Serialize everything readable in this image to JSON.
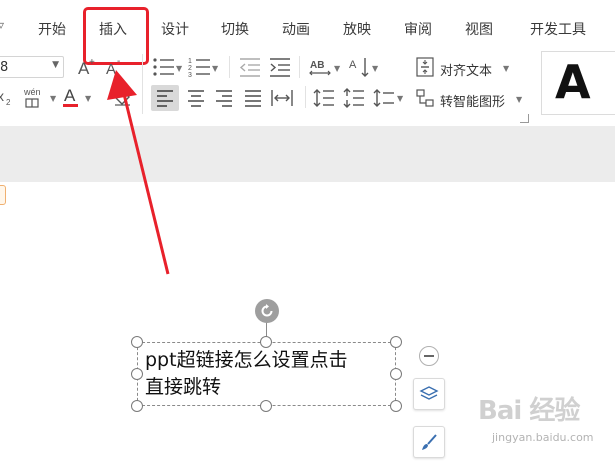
{
  "ribbon": {
    "tabs": [
      {
        "label": "开始"
      },
      {
        "label": "插入"
      },
      {
        "label": "设计"
      },
      {
        "label": "切换"
      },
      {
        "label": "动画"
      },
      {
        "label": "放映"
      },
      {
        "label": "审阅"
      },
      {
        "label": "视图"
      },
      {
        "label": "开发工具"
      }
    ],
    "highlighted_tab": "插入",
    "font_size_value": "8",
    "phonetic_label": "wén",
    "font_color_glyph": "A",
    "align_text_label": "对齐文本",
    "smartart_label": "转智能图形",
    "shape_style_glyph": "A"
  },
  "textbox": {
    "text_line1": "ppt超链接怎么设置点击",
    "text_line2": "直接跳转"
  },
  "watermark": {
    "brand": "Bai 经验",
    "url": "jingyan.baidu.com"
  },
  "colors": {
    "highlight_box": "#e8212b",
    "annotation_arrow": "#e8212b",
    "font_color_underline": "#e8212b",
    "ribbon_bg": "#ffffff",
    "workspace_bg": "#ececec"
  },
  "icons": [
    "font-grow-icon",
    "font-shrink-icon",
    "subscript-icon",
    "phonetic-guide-icon",
    "font-color-icon",
    "clear-format-icon",
    "bullet-list-icon",
    "numbered-list-icon",
    "decrease-indent-icon",
    "increase-indent-icon",
    "character-spacing-icon",
    "text-direction-icon",
    "align-left-icon",
    "align-center-icon",
    "align-right-icon",
    "justify-icon",
    "distribute-icon",
    "line-spacing-icon",
    "paragraph-spacing-icon",
    "paragraph-spacing-alt-icon",
    "align-text-icon",
    "smartart-icon",
    "rotate-icon",
    "layers-icon",
    "brush-icon",
    "collapse-icon"
  ]
}
